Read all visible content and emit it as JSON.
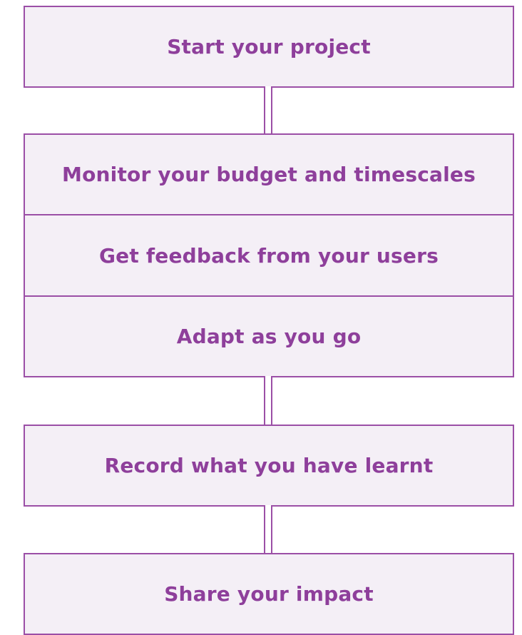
{
  "diagram": {
    "colors": {
      "accent": "#9b4fa6",
      "text": "#8e3f9b",
      "box_fill": "#f4eff6"
    },
    "steps": [
      {
        "label": "Start your project"
      },
      {
        "label": "Monitor your budget and timescales"
      },
      {
        "label": "Get feedback from your users"
      },
      {
        "label": "Adapt as you go"
      },
      {
        "label": "Record what you have learnt"
      },
      {
        "label": "Share your impact"
      }
    ]
  }
}
